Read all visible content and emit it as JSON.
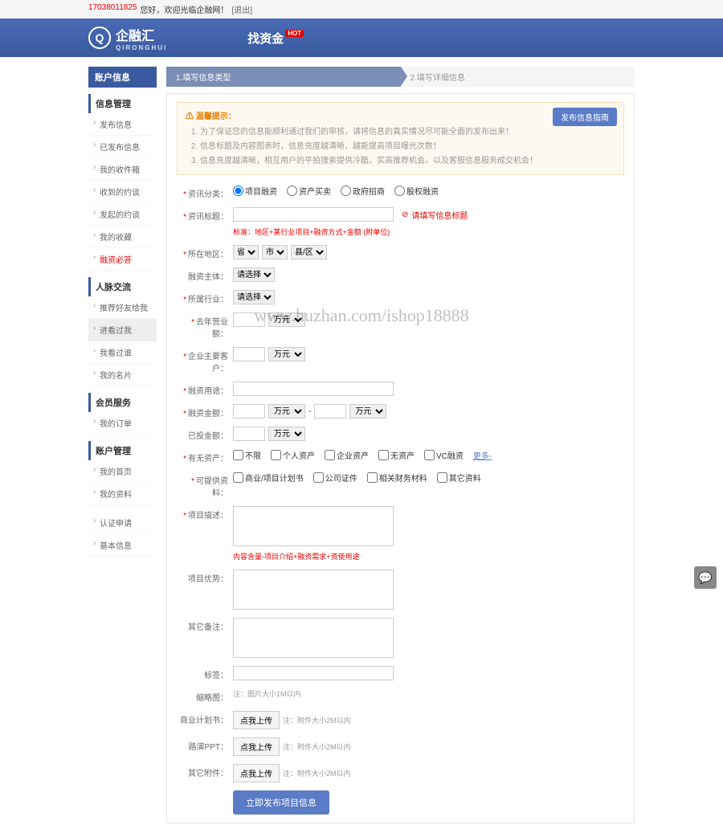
{
  "topbar": {
    "user": "17038011825",
    "greet": "您好，欢迎光临企融网！",
    "logout": "[退出]"
  },
  "header": {
    "logo": "企融汇",
    "logo_sub": "QIRONGHUI",
    "nav": "找资金",
    "hot": "HOT"
  },
  "sidebar": {
    "title": "账户信息",
    "s1": "信息管理",
    "s1_items": [
      "发布信息",
      "已发布信息",
      "我的收件箱",
      "收到的约谈",
      "发起的约谈",
      "我的收藏",
      "融资必答"
    ],
    "s2": "人脉交流",
    "s2_items": [
      "推荐好友给我",
      "进看过我",
      "我看过谁",
      "我的名片"
    ],
    "s3": "会员服务",
    "s3_items": [
      "我的订单"
    ],
    "s4": "账户管理",
    "s4_items": [
      "我的首页",
      "我的资料"
    ],
    "s4b_items": [
      "认证申请",
      "基本信息"
    ]
  },
  "steps": {
    "s1": "1.填写信息类型",
    "s2": "2.填写详细信息"
  },
  "tips": {
    "title": "温馨提示：",
    "items": [
      "为了保证您的信息能顺利通过我们的审核，请将信息的真实情况尽可能全面的发布出来！",
      "信息标题及内容图表时，信息充度越清晰，越能提高项目曝光次数！",
      "信息充度越清晰，相互用户的平拍搜索提供冷酷，实高推荐机会。以及客服信息服务成交机会！"
    ],
    "btn": "发布信息指南"
  },
  "form": {
    "category": {
      "label": "资讯分类：",
      "opts": [
        "项目融资",
        "资产买卖",
        "政府招商",
        "股权融资"
      ]
    },
    "title": {
      "label": "资讯标题：",
      "hint": "标准：地区+某行业项目+融资方式+金额 (附单位)",
      "err": "请填写信息标题"
    },
    "area": {
      "label": "所在地区：",
      "opts": [
        "省",
        "市",
        "县/区"
      ]
    },
    "entity": {
      "label": "融资主体：",
      "placeholder": "请选择"
    },
    "industry": {
      "label": "所属行业：",
      "placeholder": "请选择"
    },
    "revenue": {
      "label": "去年营业额：",
      "unit": "万元"
    },
    "net": {
      "label": "企业主要客户：",
      "unit": "万元"
    },
    "usage": {
      "label": "融资用途："
    },
    "amount": {
      "label": "融资金额：",
      "unit": "万元",
      "sep": "-"
    },
    "invest": {
      "label": "已投金额：",
      "unit": "万元"
    },
    "collateral": {
      "label": "有无资产：",
      "opts": [
        "不限",
        "个人资产",
        "企业资产",
        "无资产",
        "VC融资"
      ],
      "more": "更多-"
    },
    "docs": {
      "label": "可提供资料：",
      "opts": [
        "商业/项目计划书",
        "公司证件",
        "相关财务材料",
        "其它资料"
      ]
    },
    "desc": {
      "label": "项目描述：",
      "hint": "内容含量-项目介绍+融资需求+资使用途"
    },
    "adv": {
      "label": "项目优势："
    },
    "other": {
      "label": "其它备注："
    },
    "tags": {
      "label": "标签："
    },
    "thumb": {
      "label": "缩略图：",
      "hint": "注：图片大小1M以内"
    },
    "plan": {
      "label": "商业计划书：",
      "btn": "点我上传",
      "hint": "注：附件大小2M以内"
    },
    "roadshow": {
      "label": "路演PPT：",
      "btn": "点我上传",
      "hint": "注：附件大小2M以内"
    },
    "attach": {
      "label": "其它附件：",
      "btn": "点我上传",
      "hint": "注：附件大小2M以内"
    },
    "submit": "立即发布项目信息"
  },
  "watermark": "www.huzhan.com/ishop18888"
}
